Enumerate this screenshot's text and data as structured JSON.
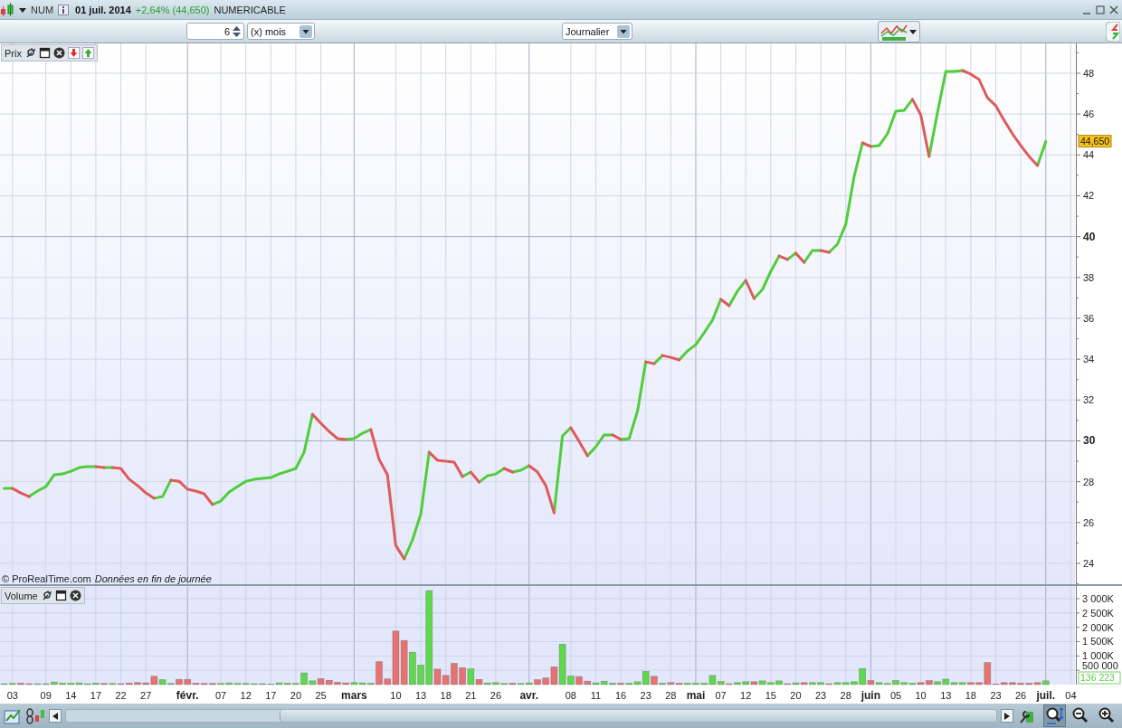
{
  "title_bar": {
    "symbol": "NUM",
    "date": "01 juil. 2014",
    "change": "+2,64% (44,650)",
    "name": "NUMERICABLE"
  },
  "toolbar": {
    "period": {
      "value": "6"
    },
    "unit_dropdown": {
      "value": "(x) mois"
    },
    "timeframe_dropdown": {
      "value": "Journalier"
    }
  },
  "price_panel": {
    "label": "Prix",
    "footer": "© ProRealTime.com",
    "footer_note": "Données en fin de journée",
    "last_value": "44,650",
    "chart_data": {
      "type": "line",
      "grid": true,
      "ylim": [
        22.98,
        49.46
      ],
      "categories": [
        null,
        null,
        null,
        null,
        null,
        null,
        null,
        null,
        null,
        null,
        null,
        null,
        null,
        null,
        null,
        null,
        null,
        null,
        null,
        null,
        null,
        null,
        null,
        null,
        null,
        null,
        null,
        null,
        null,
        null,
        null,
        null,
        null,
        null,
        null,
        null,
        null,
        null,
        null,
        null,
        null,
        null,
        null,
        null,
        null,
        null,
        null,
        null,
        null,
        null,
        null,
        null,
        null,
        null,
        null,
        null,
        null,
        null,
        null,
        null,
        null,
        null,
        null,
        null,
        null,
        null,
        null,
        null,
        null,
        null,
        null,
        null,
        null,
        null,
        null,
        null,
        null,
        null,
        null,
        null,
        null,
        null,
        null,
        null,
        null,
        null,
        null,
        null,
        null,
        null,
        null,
        null,
        null,
        null,
        null,
        null,
        null,
        null,
        null,
        null,
        null,
        null,
        null,
        null,
        null,
        null,
        null,
        null,
        null,
        null,
        null,
        null,
        null,
        null,
        null,
        null,
        null,
        null,
        null,
        null,
        null,
        null,
        null,
        null,
        null,
        null,
        null,
        null,
        null
      ],
      "yticks": [
        24,
        26,
        28,
        30,
        32,
        34,
        36,
        38,
        40,
        42,
        44,
        46,
        48
      ],
      "series": [
        {
          "color": "#4fcd3a",
          "values": [
            27.67,
            27.67,
            null,
            27.27,
            27.54,
            27.76,
            28.34,
            28.38,
            28.51,
            28.69,
            28.74,
            28.74,
            28.69,
            28.69,
            null,
            null,
            null,
            null,
            27.19,
            27.27,
            28.07,
            null,
            null,
            null,
            null,
            26.88,
            27.05,
            27.5,
            27.76,
            28.02,
            28.11,
            28.16,
            28.2,
            28.38,
            28.51,
            28.65,
            29.44,
            31.3,
            null,
            null,
            null,
            30.07,
            30.11,
            30.37,
            30.55,
            null,
            null,
            null,
            24.22,
            25.15,
            26.43,
            29.44,
            null,
            null,
            null,
            28.25,
            28.47,
            27.98,
            28.29,
            28.38,
            28.65,
            28.47,
            28.56,
            28.78,
            null,
            null,
            26.48,
            30.24,
            30.64,
            null,
            29.27,
            29.71,
            30.29,
            30.29,
            30.07,
            30.11,
            31.44,
            33.87,
            33.78,
            34.18,
            null,
            33.96,
            34.4,
            34.71,
            35.29,
            35.91,
            36.93,
            36.62,
            37.33,
            37.86,
            36.97,
            37.42,
            38.3,
            39.05,
            38.88,
            39.19,
            38.74,
            39.32,
            39.32,
            39.23,
            39.63,
            40.6,
            42.95,
            44.59,
            44.41,
            44.46,
            45.03,
            46.14,
            46.18,
            46.72,
            null,
            43.93,
            46.05,
            48.09,
            48.09,
            48.13,
            null,
            null,
            null,
            null,
            null,
            null,
            null,
            null,
            43.48,
            44.65,
            null,
            null,
            null
          ]
        },
        {
          "color": "#de5b5b",
          "values": [
            null,
            27.67,
            27.45,
            27.27,
            null,
            null,
            null,
            null,
            null,
            null,
            null,
            28.74,
            28.69,
            28.69,
            28.65,
            28.12,
            27.81,
            27.45,
            27.19,
            null,
            28.07,
            28.02,
            27.63,
            27.54,
            27.41,
            26.88,
            null,
            null,
            null,
            null,
            null,
            null,
            null,
            null,
            null,
            null,
            null,
            31.3,
            30.86,
            30.46,
            30.11,
            30.07,
            null,
            null,
            30.55,
            29.09,
            28.34,
            24.88,
            24.22,
            null,
            null,
            29.44,
            29.05,
            29,
            28.96,
            28.25,
            28.47,
            27.98,
            null,
            null,
            28.65,
            28.47,
            null,
            28.78,
            28.47,
            27.81,
            26.48,
            null,
            30.64,
            29.98,
            29.27,
            null,
            null,
            30.29,
            30.07,
            null,
            null,
            33.87,
            33.78,
            34.18,
            34.09,
            33.96,
            null,
            null,
            null,
            null,
            36.93,
            36.62,
            null,
            37.86,
            36.97,
            null,
            null,
            39.05,
            38.88,
            39.19,
            38.74,
            null,
            39.32,
            39.23,
            null,
            null,
            null,
            44.59,
            44.41,
            null,
            null,
            null,
            null,
            46.72,
            45.96,
            43.93,
            null,
            null,
            null,
            48.13,
            47.96,
            47.69,
            46.8,
            46.41,
            45.7,
            45.03,
            44.46,
            43.93,
            43.48,
            null,
            null,
            null,
            null
          ]
        }
      ]
    }
  },
  "volume_panel": {
    "label": "Volume",
    "last_value": "136 223",
    "chart_data": {
      "type": "bar",
      "grid": true,
      "ylim": [
        0,
        3442000
      ],
      "categories": [
        null,
        "03",
        null,
        null,
        null,
        "09",
        null,
        null,
        "14",
        null,
        null,
        "17",
        null,
        null,
        "22",
        null,
        null,
        "27",
        null,
        null,
        null,
        null,
        "févr.",
        null,
        null,
        null,
        "07",
        null,
        null,
        "12",
        null,
        null,
        "17",
        null,
        null,
        "20",
        null,
        null,
        "25",
        null,
        null,
        null,
        "mars",
        null,
        null,
        null,
        null,
        "10",
        null,
        null,
        "13",
        null,
        null,
        "18",
        null,
        null,
        "21",
        null,
        null,
        "26",
        null,
        null,
        null,
        "avr.",
        null,
        null,
        null,
        null,
        "08",
        null,
        null,
        "11",
        null,
        null,
        "16",
        null,
        null,
        "23",
        null,
        null,
        "28",
        null,
        null,
        "mai",
        null,
        null,
        "07",
        null,
        null,
        "12",
        null,
        null,
        "15",
        null,
        null,
        "20",
        null,
        null,
        "23",
        null,
        null,
        "28",
        null,
        null,
        "juin",
        null,
        null,
        "05",
        null,
        null,
        "10",
        null,
        null,
        "13",
        null,
        null,
        "18",
        null,
        null,
        "23",
        null,
        null,
        "26",
        null,
        null,
        "juil.",
        null,
        null,
        "04"
      ],
      "yticks": [
        {
          "value": 500000,
          "label": "500 000"
        },
        {
          "value": 1000000,
          "label": "1 000K"
        },
        {
          "value": 1500000,
          "label": "1 500K"
        },
        {
          "value": 2000000,
          "label": "2 000K"
        },
        {
          "value": 2500000,
          "label": "2 500K"
        },
        {
          "value": 3000000,
          "label": "3 000K"
        }
      ],
      "series": [
        {
          "color": "#5ed84c",
          "values": [
            30000,
            40000,
            null,
            null,
            30000,
            30000,
            90000,
            50000,
            50000,
            60000,
            30000,
            50000,
            null,
            40000,
            null,
            null,
            null,
            null,
            null,
            170000,
            40000,
            null,
            null,
            null,
            null,
            null,
            40000,
            60000,
            40000,
            40000,
            30000,
            30000,
            20000,
            60000,
            50000,
            40000,
            410000,
            130000,
            null,
            null,
            null,
            null,
            70000,
            60000,
            50000,
            null,
            null,
            null,
            null,
            1130000,
            680000,
            3280000,
            null,
            null,
            null,
            null,
            550000,
            null,
            60000,
            70000,
            40000,
            null,
            40000,
            60000,
            null,
            null,
            null,
            1410000,
            300000,
            null,
            null,
            60000,
            120000,
            50000,
            null,
            50000,
            100000,
            460000,
            null,
            50000,
            null,
            null,
            50000,
            50000,
            50000,
            320000,
            110000,
            null,
            70000,
            100000,
            null,
            130000,
            70000,
            130000,
            null,
            60000,
            null,
            70000,
            70000,
            null,
            70000,
            70000,
            100000,
            560000,
            null,
            70000,
            40000,
            140000,
            70000,
            50000,
            null,
            null,
            100000,
            190000,
            70000,
            70000,
            null,
            null,
            null,
            null,
            null,
            null,
            null,
            null,
            null,
            130000,
            null,
            null,
            null
          ]
        },
        {
          "color": "#e87272",
          "values": [
            null,
            null,
            50000,
            30000,
            null,
            null,
            null,
            null,
            null,
            null,
            null,
            null,
            40000,
            null,
            30000,
            50000,
            70000,
            60000,
            290000,
            null,
            null,
            180000,
            180000,
            50000,
            40000,
            40000,
            null,
            null,
            null,
            null,
            null,
            null,
            null,
            null,
            null,
            null,
            null,
            null,
            210000,
            150000,
            80000,
            60000,
            null,
            null,
            null,
            800000,
            200000,
            1870000,
            1540000,
            null,
            null,
            null,
            540000,
            320000,
            740000,
            590000,
            null,
            180000,
            null,
            null,
            null,
            50000,
            null,
            null,
            170000,
            230000,
            620000,
            null,
            null,
            280000,
            120000,
            null,
            null,
            null,
            50000,
            null,
            null,
            null,
            290000,
            null,
            70000,
            50000,
            null,
            null,
            null,
            null,
            null,
            30000,
            null,
            null,
            100000,
            null,
            null,
            null,
            30000,
            null,
            70000,
            null,
            null,
            30000,
            null,
            null,
            null,
            null,
            140000,
            null,
            null,
            null,
            null,
            null,
            70000,
            140000,
            null,
            null,
            null,
            null,
            70000,
            70000,
            770000,
            20000,
            70000,
            70000,
            50000,
            50000,
            70000,
            null,
            null,
            null,
            null
          ]
        }
      ]
    }
  },
  "bottom_bar": {
    "tools": [
      {
        "kind": "settings",
        "selected": false
      },
      {
        "kind": "zoom-fit",
        "selected": true
      },
      {
        "kind": "zoom-out",
        "selected": false
      },
      {
        "kind": "zoom-in",
        "selected": false
      }
    ]
  }
}
